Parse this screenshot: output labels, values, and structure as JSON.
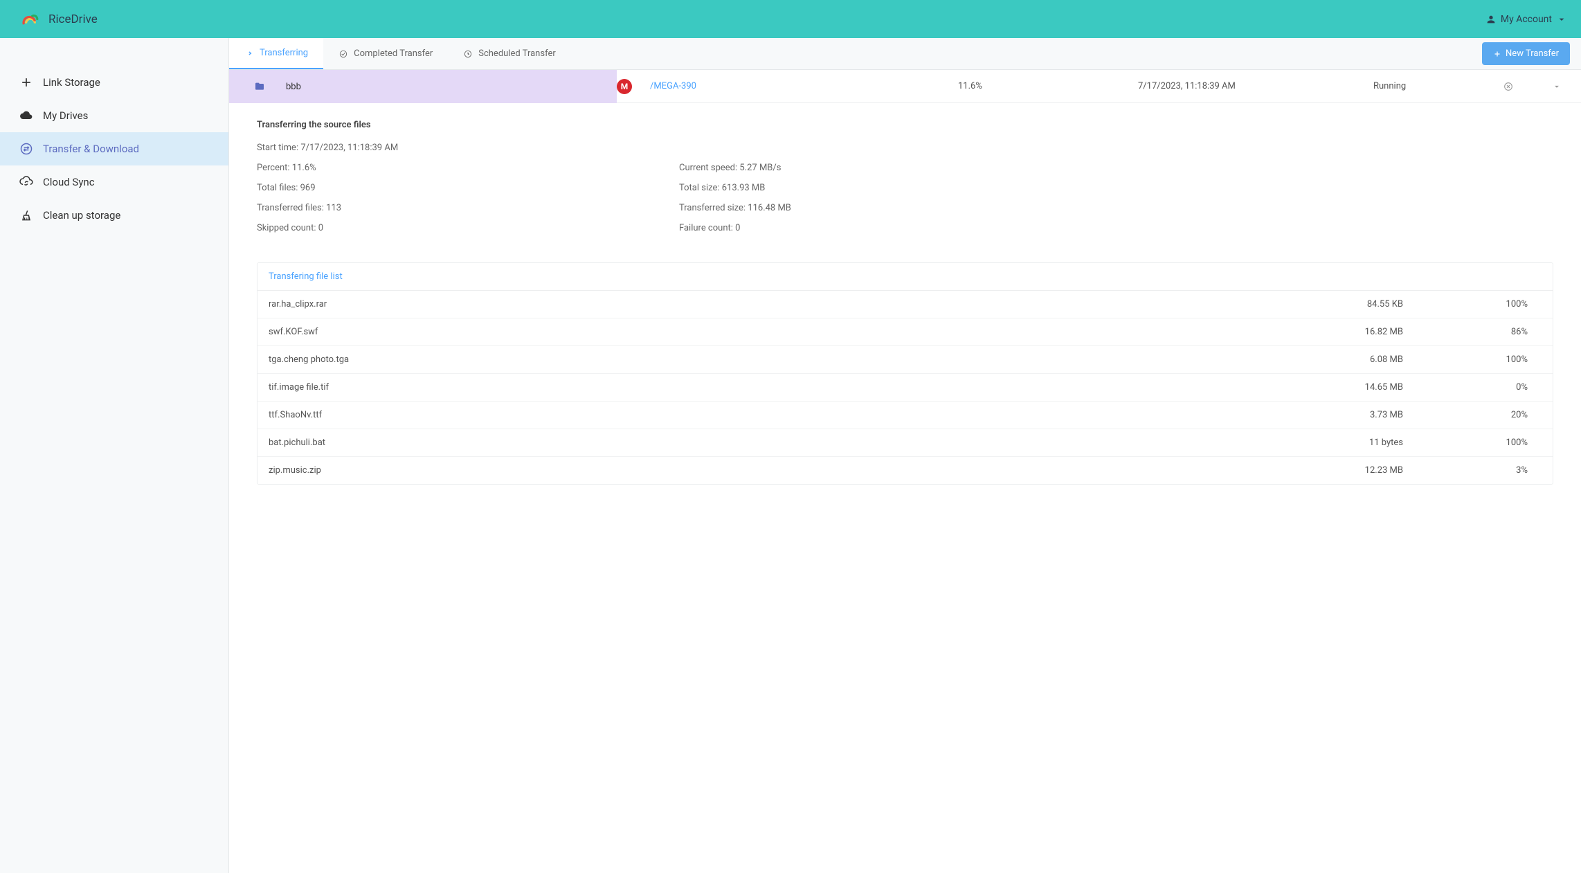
{
  "header": {
    "brand": "RiceDrive",
    "account_label": "My Account"
  },
  "sidebar": {
    "items": [
      {
        "label": "Link Storage"
      },
      {
        "label": "My Drives"
      },
      {
        "label": "Transfer & Download"
      },
      {
        "label": "Cloud Sync"
      },
      {
        "label": "Clean up storage"
      }
    ]
  },
  "tabs": {
    "transferring": "Transferring",
    "completed": "Completed Transfer",
    "scheduled": "Scheduled Transfer",
    "new_transfer": "New Transfer"
  },
  "transfer": {
    "source_name": "bbb",
    "dest_name": "/MEGA-390",
    "percent": "11.6%",
    "time": "7/17/2023, 11:18:39 AM",
    "status": "Running"
  },
  "details": {
    "title": "Transferring the source files",
    "start_time": "Start time: 7/17/2023, 11:18:39 AM",
    "percent": "Percent: 11.6%",
    "current_speed": "Current speed: 5.27 MB/s",
    "total_files": "Total files: 969",
    "total_size": "Total size: 613.93 MB",
    "transferred_files": "Transferred files: 113",
    "transferred_size": "Transferred size: 116.48 MB",
    "skipped_count": "Skipped count: 0",
    "failure_count": "Failure count: 0"
  },
  "filelist": {
    "header": "Transfering file list",
    "rows": [
      {
        "name": "rar.ha_clipx.rar",
        "size": "84.55 KB",
        "pct": "100%"
      },
      {
        "name": "swf.KOF.swf",
        "size": "16.82 MB",
        "pct": "86%"
      },
      {
        "name": "tga.cheng photo.tga",
        "size": "6.08 MB",
        "pct": "100%"
      },
      {
        "name": "tif.image file.tif",
        "size": "14.65 MB",
        "pct": "0%"
      },
      {
        "name": "ttf.ShaoNv.ttf",
        "size": "3.73 MB",
        "pct": "20%"
      },
      {
        "name": "bat.pichuli.bat",
        "size": "11 bytes",
        "pct": "100%"
      },
      {
        "name": "zip.music.zip",
        "size": "12.23 MB",
        "pct": "3%"
      }
    ]
  }
}
